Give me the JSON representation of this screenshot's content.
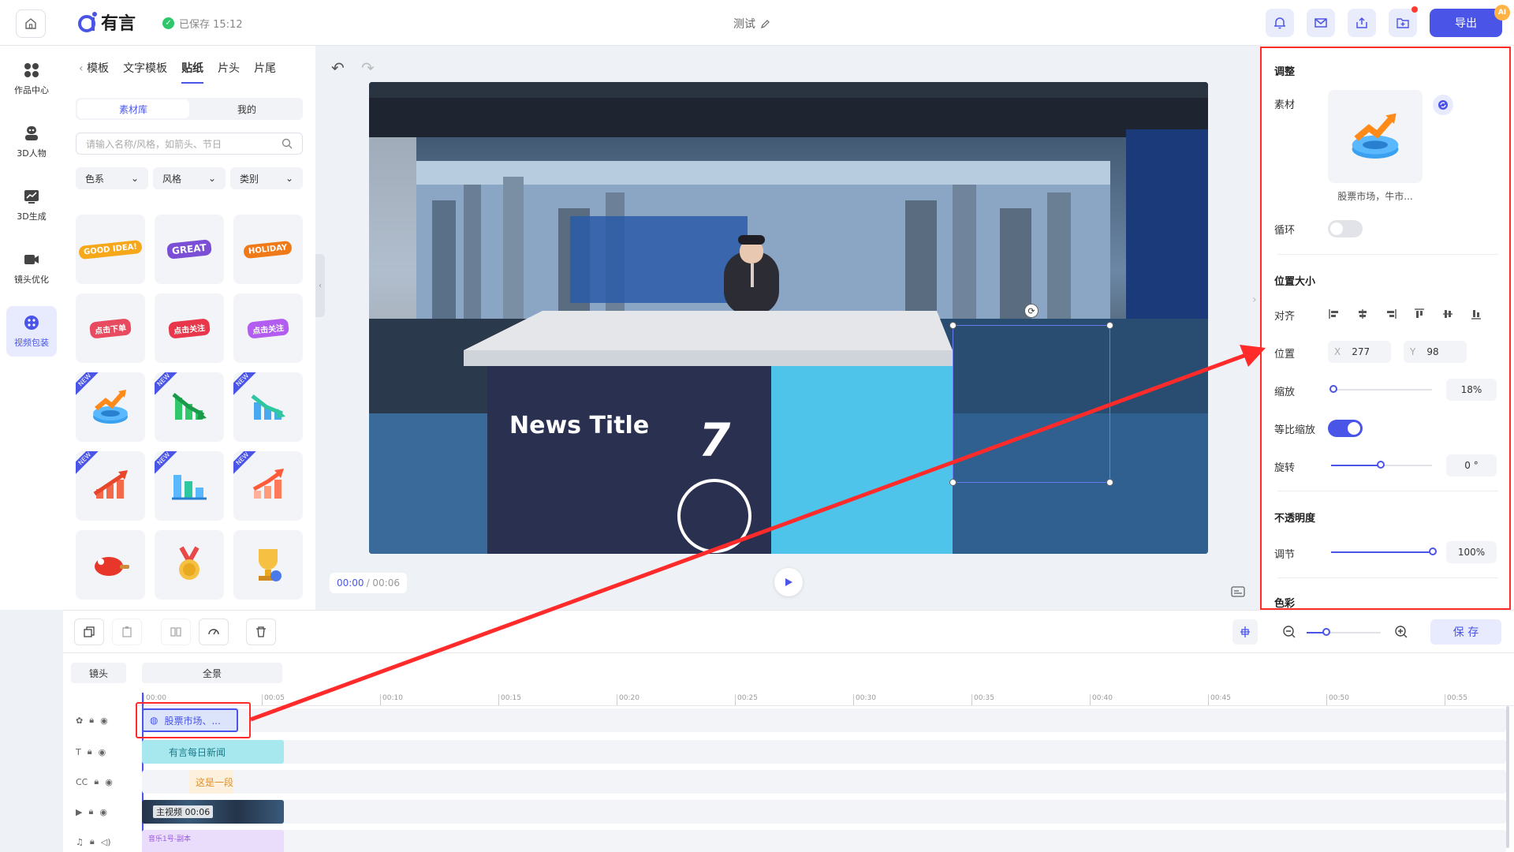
{
  "topbar": {
    "saved_text": "已保存 15:12",
    "doc_title": "测试",
    "export_label": "导出",
    "ai_badge": "AI"
  },
  "nav": [
    {
      "label": "作品中心",
      "icon": "grid-icon"
    },
    {
      "label": "3D人物",
      "icon": "person-icon"
    },
    {
      "label": "3D生成",
      "icon": "chart-icon"
    },
    {
      "label": "镜头优化",
      "icon": "camera-icon"
    },
    {
      "label": "视频包装",
      "icon": "palette-icon"
    }
  ],
  "assets": {
    "tabs": [
      "模板",
      "文字模板",
      "贴纸",
      "片头",
      "片尾"
    ],
    "active_tab": "贴纸",
    "subtabs": [
      "素材库",
      "我的"
    ],
    "search_placeholder": "请输入名称/风格，如箭头、节日",
    "filters": [
      "色系",
      "风格",
      "类别"
    ],
    "tiles": [
      {
        "label": "GOOD IDEA!",
        "color": "#f6a81a"
      },
      {
        "label": "GREAT",
        "color": "#7a4fd6"
      },
      {
        "label": "HOLIDAY",
        "color": "#f07a18"
      },
      {
        "label": "点击下单",
        "color": "#e84a5f"
      },
      {
        "label": "点击关注",
        "color": "#e8364a"
      },
      {
        "label": "点击关注",
        "color": "#b25df0"
      }
    ],
    "new_badge": "NEW"
  },
  "preview": {
    "news_title": "News Title",
    "channel_number": "7",
    "time_current": "00:00",
    "time_total": "/ 00:06"
  },
  "panel": {
    "adjust_title": "调整",
    "material_label": "素材",
    "material_name": "股票市场，牛市...",
    "loop_label": "循环",
    "pos_size_title": "位置大小",
    "align_label": "对齐",
    "position_label": "位置",
    "x_label": "X",
    "x_value": "277",
    "y_label": "Y",
    "y_value": "98",
    "scale_label": "缩放",
    "scale_value": "18%",
    "scale_fraction": 0.18,
    "ratio_label": "等比缩放",
    "rotate_label": "旋转",
    "rotate_value": "0 °",
    "opacity_title": "不透明度",
    "opacity_label": "调节",
    "opacity_value": "100%",
    "color_title": "色彩"
  },
  "toolbar": {
    "save_label": "保 存"
  },
  "timeline": {
    "shot_label": "镜头",
    "scene_label": "全景",
    "ticks": [
      "00:00",
      "00:05",
      "00:10",
      "00:15",
      "00:20",
      "00:25",
      "00:30",
      "00:35",
      "00:40",
      "00:45",
      "00:50",
      "00:55"
    ],
    "clips": {
      "sticker": "股票市场、...",
      "text": "有言每日新闻",
      "subtitle": "这是一段",
      "video": "主视频 00:06",
      "audio": "音乐1号-副本"
    }
  }
}
